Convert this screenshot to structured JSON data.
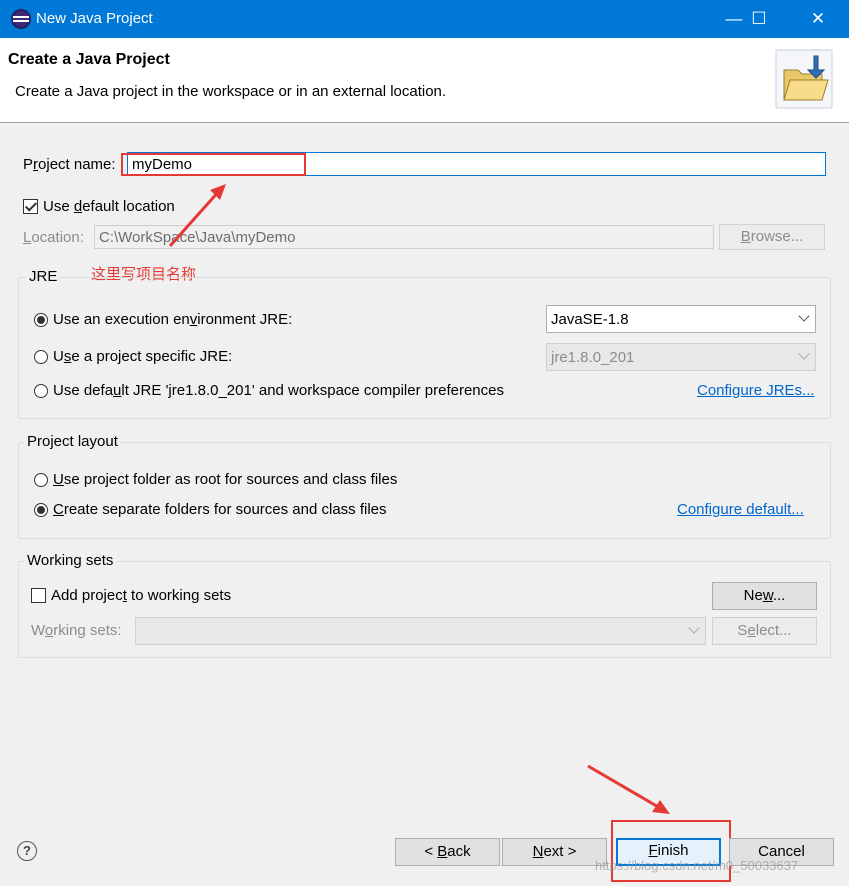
{
  "window": {
    "title": "New Java Project",
    "controls": {
      "minimize": "—",
      "maximize": "☐",
      "close": "✕"
    }
  },
  "header": {
    "title": "Create a Java Project",
    "description": "Create a Java project in the workspace or in an external location."
  },
  "form": {
    "project_name": {
      "label_pre": "P",
      "label_u": "r",
      "label_post": "oject name:",
      "value": "myDemo"
    },
    "use_default_location": {
      "pre": "Use ",
      "u": "d",
      "post": "efault location",
      "checked": true
    },
    "location": {
      "label_pre": "",
      "label_u": "L",
      "label_post": "ocation:",
      "value": "C:\\WorkSpace\\Java\\myDemo",
      "browse_button_pre": "",
      "browse_button_u": "B",
      "browse_button_post": "rowse..."
    }
  },
  "annotation": {
    "text": "这里写项目名称",
    "color": "#e53935"
  },
  "jre": {
    "title": "JRE",
    "option_execution_env": {
      "pre": "Use an execution en",
      "u": "v",
      "post": "ironment JRE:",
      "selected": true
    },
    "execution_env_value": "JavaSE-1.8",
    "option_project_specific": {
      "pre": "U",
      "u": "s",
      "post": "e a project specific JRE:",
      "selected": false
    },
    "project_specific_value": "jre1.8.0_201",
    "option_default": {
      "pre": "Use defa",
      "u": "u",
      "post": "lt JRE 'jre1.8.0_201' and workspace compiler preferences",
      "selected": false
    },
    "configure_link": "Configure JREs..."
  },
  "layout": {
    "title": "Project layout",
    "option_root": {
      "pre": "",
      "u": "U",
      "post": "se project folder as root for sources and class files",
      "selected": false
    },
    "option_separate": {
      "pre": "",
      "u": "C",
      "post": "reate separate folders for sources and class files",
      "selected": true
    },
    "configure_link": "Configure default..."
  },
  "working_sets": {
    "title": "Working sets",
    "add_checkbox": {
      "pre": "Add projec",
      "u": "t",
      "post": " to working sets",
      "checked": false
    },
    "new_button": {
      "pre": "Ne",
      "u": "w",
      "post": "..."
    },
    "label": {
      "pre": "W",
      "u": "o",
      "post": "rking sets:"
    },
    "select_button": {
      "pre": "S",
      "u": "e",
      "post": "lect..."
    }
  },
  "footer": {
    "help": "?",
    "back": {
      "pre": "< ",
      "u": "B",
      "post": "ack"
    },
    "next": {
      "pre": "",
      "u": "N",
      "post": "ext >"
    },
    "finish": {
      "pre": "",
      "u": "F",
      "post": "inish"
    },
    "cancel": "Cancel",
    "watermark": "https://blog.csdn.net/m0_50033637"
  }
}
